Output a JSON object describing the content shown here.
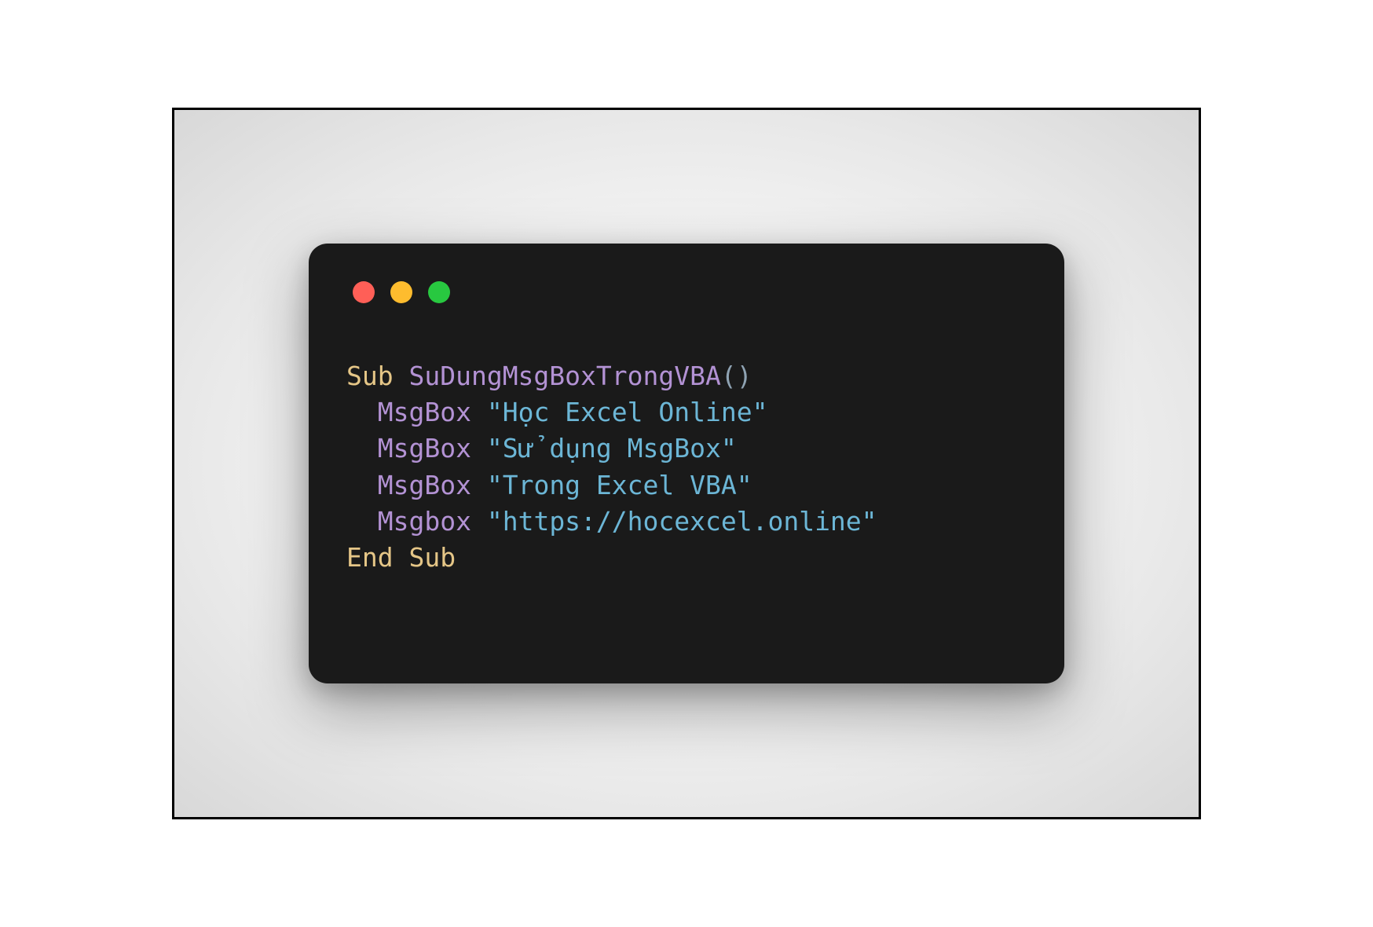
{
  "code": {
    "line1": {
      "keyword": "Sub",
      "funcName": "SuDungMsgBoxTrongVBA",
      "parens": "()"
    },
    "line2": {
      "indent": "  ",
      "func": "MsgBox",
      "space": " ",
      "string": "\"Học Excel Online\""
    },
    "line3": {
      "indent": "  ",
      "func": "MsgBox",
      "space": " ",
      "string": "\"Sử dụng MsgBox\""
    },
    "line4": {
      "indent": "  ",
      "func": "MsgBox",
      "space": " ",
      "string": "\"Trong Excel VBA\""
    },
    "line5": {
      "indent": "  ",
      "func": "Msgbox",
      "space": " ",
      "string": "\"https://hocexcel.online\""
    },
    "line6": {
      "keyword": "End Sub"
    }
  },
  "colors": {
    "windowBg": "#1a1a1a",
    "red": "#ff5f57",
    "yellow": "#febc2e",
    "green": "#28c840",
    "keyword": "#e5c687",
    "function": "#b392d4",
    "string": "#6cb6d6",
    "paren": "#8fa3b3"
  }
}
